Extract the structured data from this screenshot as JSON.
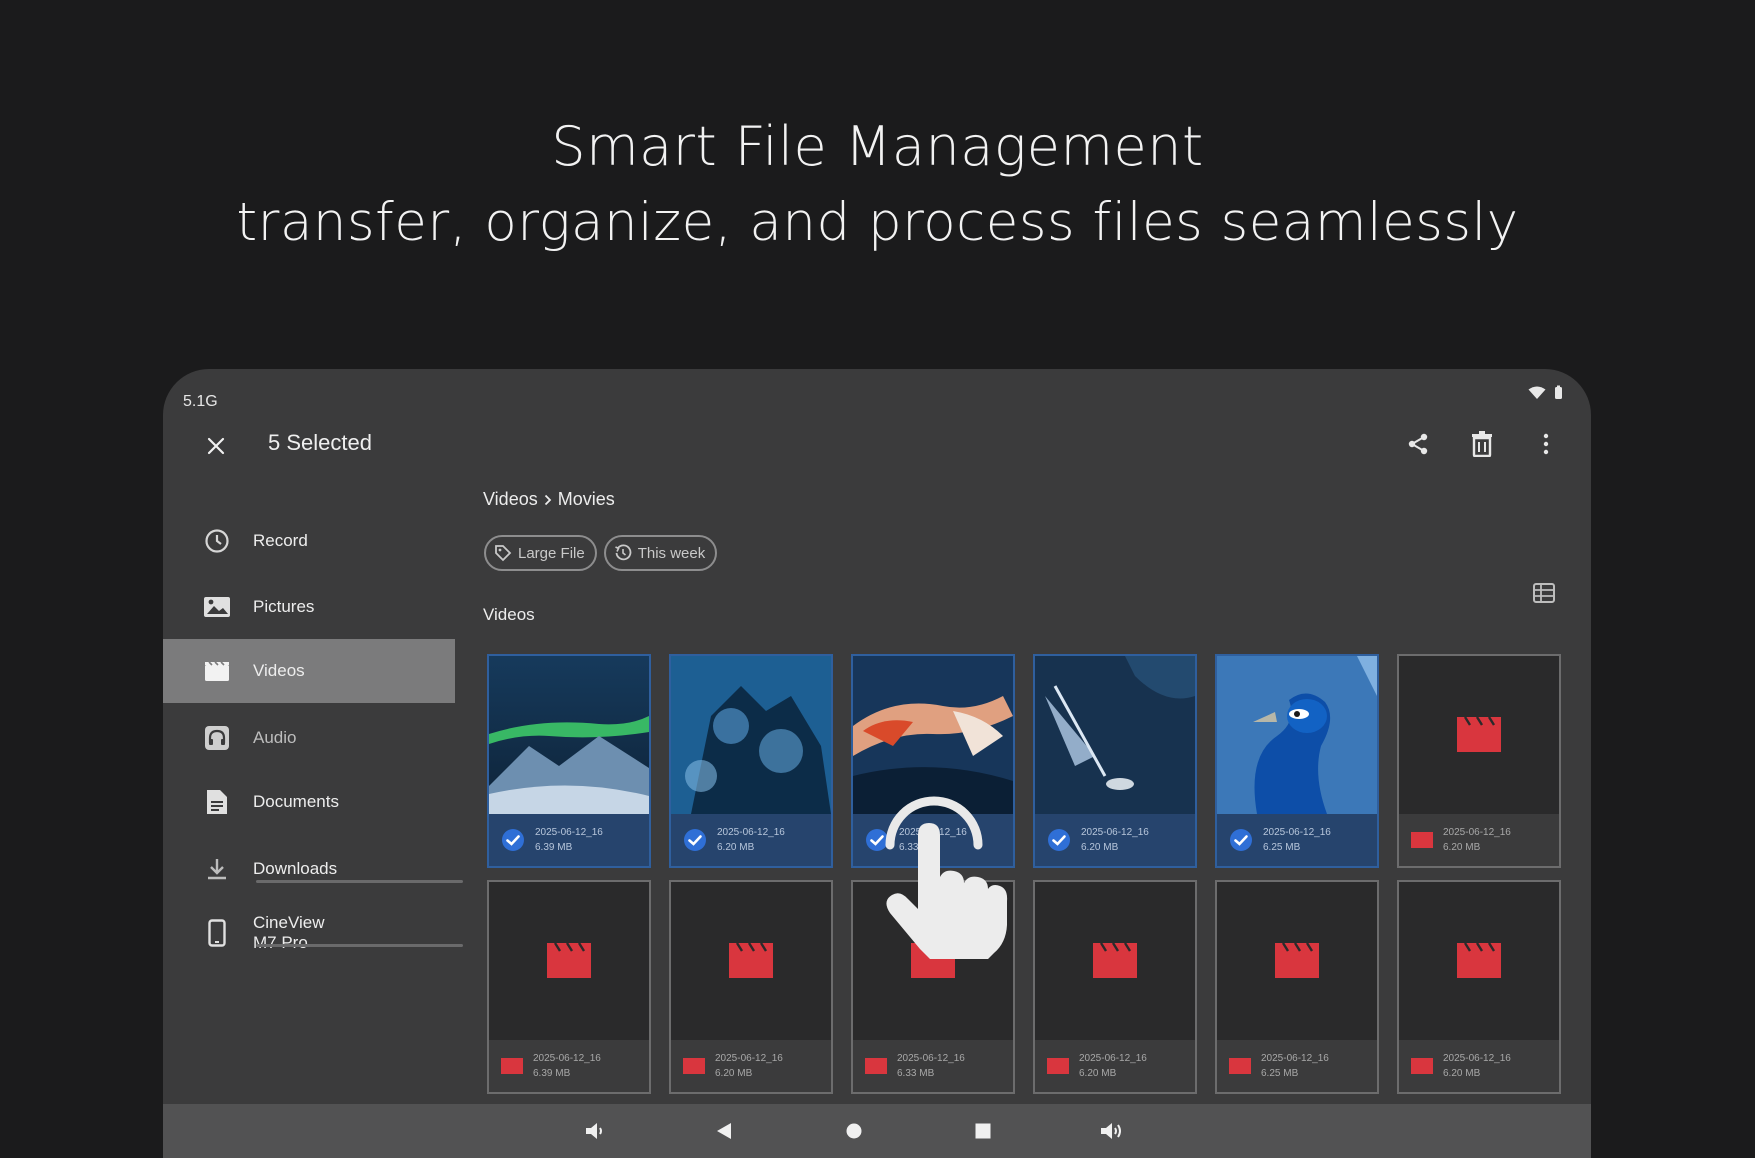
{
  "headline": {
    "line1": "Smart File Management",
    "line2": "transfer, organize, and process files seamlessly"
  },
  "status_bar": {
    "storage": "5.1G",
    "icons": [
      "wifi-icon",
      "battery-icon"
    ]
  },
  "app_bar": {
    "title": "5 Selected",
    "close_icon": "close-icon",
    "actions": [
      "share-icon",
      "delete-icon",
      "more-vert-icon"
    ]
  },
  "sidebar": {
    "items": [
      {
        "label": "Record",
        "icon": "clock-icon",
        "active": false
      },
      {
        "label": "Pictures",
        "icon": "image-icon",
        "active": false
      },
      {
        "label": "Videos",
        "icon": "video-icon",
        "active": true
      },
      {
        "label": "Audio",
        "icon": "headphones-icon",
        "active": false
      },
      {
        "label": "Documents",
        "icon": "document-icon",
        "active": false
      },
      {
        "label": "Downloads",
        "icon": "download-icon",
        "active": false
      },
      {
        "label": "CineView M7 Pro",
        "icon": "phone-icon",
        "active": false
      }
    ]
  },
  "breadcrumb": {
    "parent": "Videos",
    "current": "Movies"
  },
  "filters": [
    {
      "label": "Large File",
      "icon": "tag-icon"
    },
    {
      "label": "This week",
      "icon": "history-icon"
    }
  ],
  "section": {
    "label": "Videos"
  },
  "files": [
    {
      "name": "2025-06-12_16",
      "size": "6.39 MB",
      "selected": true,
      "thumb": "aurora"
    },
    {
      "name": "2025-06-12_16",
      "size": "6.20 MB",
      "selected": true,
      "thumb": "reef"
    },
    {
      "name": "2025-06-12_16",
      "size": "6.33 MB",
      "selected": true,
      "thumb": "fish"
    },
    {
      "name": "2025-06-12_16",
      "size": "6.20 MB",
      "selected": true,
      "thumb": "cave"
    },
    {
      "name": "2025-06-12_16",
      "size": "6.25 MB",
      "selected": true,
      "thumb": "peacock"
    },
    {
      "name": "2025-06-12_16",
      "size": "6.20 MB",
      "selected": false,
      "thumb": "placeholder"
    },
    {
      "name": "2025-06-12_16",
      "size": "6.39 MB",
      "selected": false,
      "thumb": "placeholder"
    },
    {
      "name": "2025-06-12_16",
      "size": "6.20 MB",
      "selected": false,
      "thumb": "placeholder"
    },
    {
      "name": "2025-06-12_16",
      "size": "6.33 MB",
      "selected": false,
      "thumb": "placeholder"
    },
    {
      "name": "2025-06-12_16",
      "size": "6.20 MB",
      "selected": false,
      "thumb": "placeholder"
    },
    {
      "name": "2025-06-12_16",
      "size": "6.25 MB",
      "selected": false,
      "thumb": "placeholder"
    },
    {
      "name": "2025-06-12_16",
      "size": "6.20 MB",
      "selected": false,
      "thumb": "placeholder"
    }
  ],
  "system_nav": [
    "volume-down-icon",
    "back-icon",
    "home-icon",
    "recents-icon",
    "volume-up-icon"
  ],
  "colors": {
    "background": "#1b1b1c",
    "device": "#3b3b3c",
    "active_nav": "#7b7b7c",
    "selection": "#2f6fd6",
    "video_placeholder": "#d9363e",
    "system_nav": "#525253"
  }
}
